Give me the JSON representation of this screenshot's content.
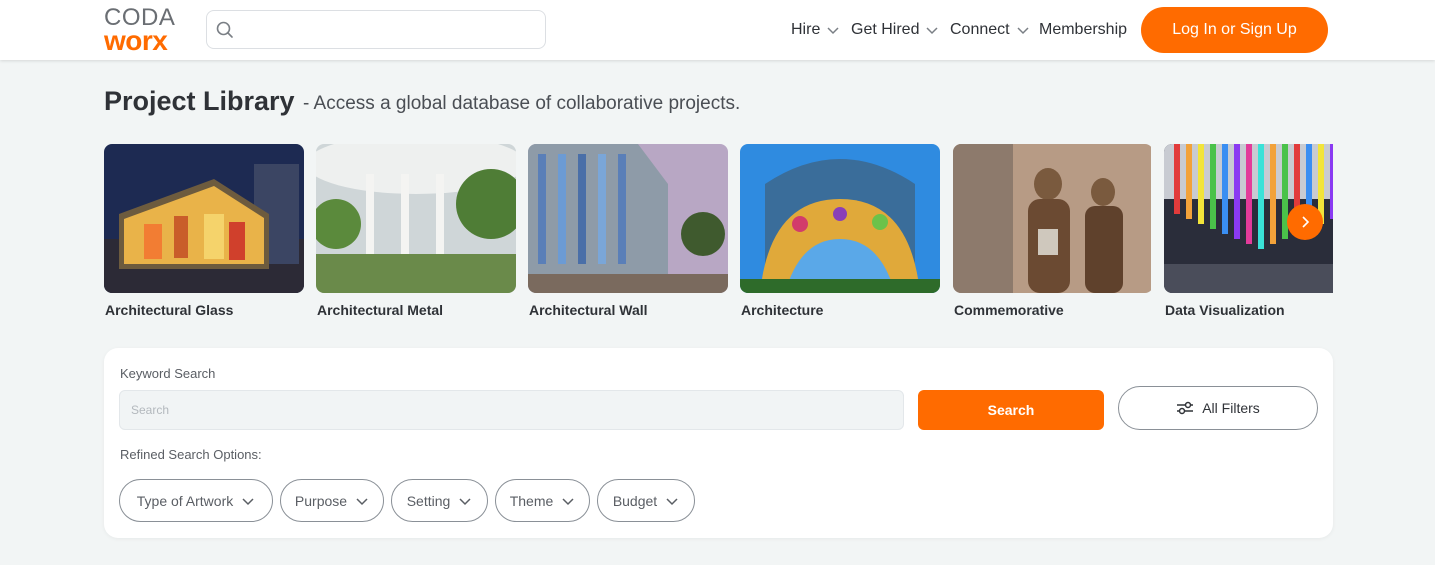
{
  "header": {
    "logo_top": "CODA",
    "logo_bottom": "worx",
    "search_placeholder": "",
    "nav": [
      {
        "label": "Hire"
      },
      {
        "label": "Get Hired"
      },
      {
        "label": "Connect"
      },
      {
        "label": "Membership"
      }
    ],
    "login_label": "Log In or Sign Up"
  },
  "page": {
    "title": "Project Library",
    "subtitle": "- Access a global database of collaborative projects."
  },
  "categories": [
    {
      "label": "Architectural Glass"
    },
    {
      "label": "Architectural Metal"
    },
    {
      "label": "Architectural Wall"
    },
    {
      "label": "Architecture"
    },
    {
      "label": "Commemorative"
    },
    {
      "label": "Data Visualization"
    }
  ],
  "search_panel": {
    "keyword_label": "Keyword Search",
    "keyword_placeholder": "Search",
    "search_button": "Search",
    "filters_button": "All Filters",
    "refined_label": "Refined Search Options:",
    "chips": [
      {
        "label": "Type of Artwork"
      },
      {
        "label": "Purpose"
      },
      {
        "label": "Setting"
      },
      {
        "label": "Theme"
      },
      {
        "label": "Budget"
      }
    ]
  },
  "colors": {
    "accent": "#ff6b00",
    "background": "#f2f5f5",
    "text": "#2f3237"
  }
}
